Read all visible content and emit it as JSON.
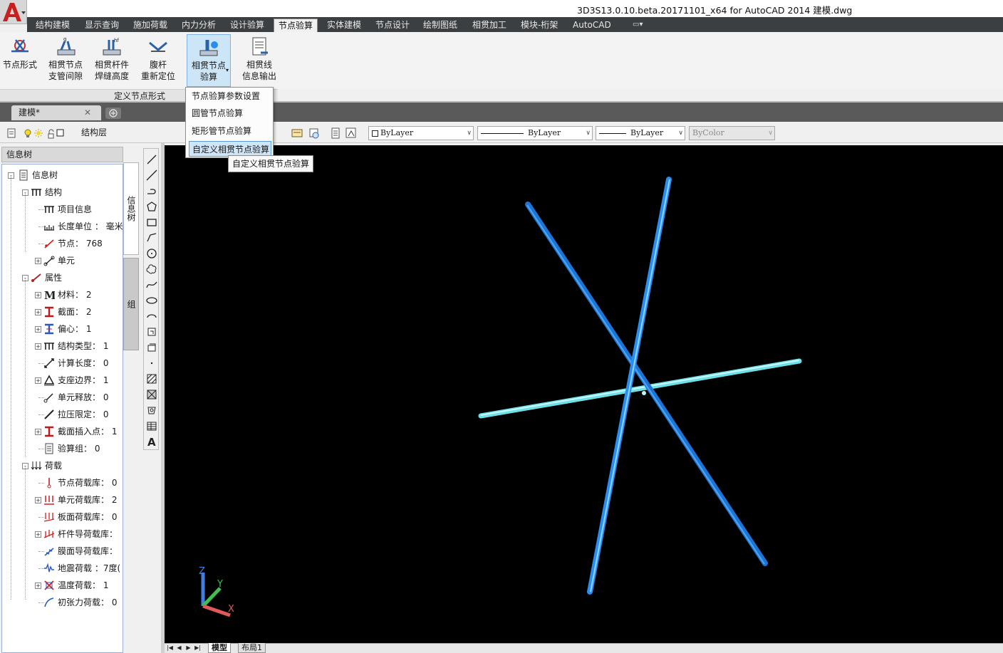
{
  "window": {
    "title": "3D3S13.0.10.beta.20171101_x64 for AutoCAD 2014     建模.dwg"
  },
  "ribbon": {
    "tabs": [
      {
        "label": "结构建模"
      },
      {
        "label": "显示查询"
      },
      {
        "label": "施加荷载"
      },
      {
        "label": "内力分析"
      },
      {
        "label": "设计验算"
      },
      {
        "label": "节点验算"
      },
      {
        "label": "实体建模"
      },
      {
        "label": "节点设计"
      },
      {
        "label": "绘制图纸"
      },
      {
        "label": "相贯加工"
      },
      {
        "label": "模块-桁架"
      },
      {
        "label": "AutoCAD"
      }
    ],
    "active_tab": "节点验算",
    "buttons": [
      {
        "line1": "节点形式",
        "line2": "",
        "icon": "node-form-icon"
      },
      {
        "line1": "相贯节点",
        "line2": "支管间隙",
        "icon": "branch-gap-icon"
      },
      {
        "line1": "相贯杆件",
        "line2": "焊缝高度",
        "icon": "weld-height-icon"
      },
      {
        "line1": "腹杆",
        "line2": "重新定位",
        "icon": "web-reposition-icon"
      },
      {
        "line1": "相贯节点",
        "line2": "验算",
        "icon": "joint-check-icon"
      },
      {
        "line1": "相贯线",
        "line2": "信息输出",
        "icon": "info-output-icon"
      }
    ],
    "group_title": "定义节点形式"
  },
  "dropdown_menu": {
    "items": [
      {
        "label": "节点验算参数设置"
      },
      {
        "label": "圆管节点验算"
      },
      {
        "label": "矩形管节点验算"
      },
      {
        "label": "自定义相贯节点验算"
      }
    ],
    "selected": "自定义相贯节点验算",
    "tooltip": "自定义相贯节点验算"
  },
  "document": {
    "tab": "建模*",
    "close_glyph": "✕"
  },
  "properties": {
    "layer": "结构层",
    "color": "ByLayer",
    "linetype": "ByLayer",
    "lineweight": "ByLayer",
    "plotstyle": "ByColor"
  },
  "left_panel": {
    "header": "信息树",
    "side_tabs": [
      "信息树",
      "组"
    ],
    "tree": [
      {
        "label": "信息树",
        "level": 0,
        "exp": "-",
        "icon": "document-icon"
      },
      {
        "label": "结构",
        "level": 1,
        "exp": "-",
        "icon": "frame-icon"
      },
      {
        "label": "项目信息",
        "level": 2,
        "exp": "",
        "icon": "frame-icon"
      },
      {
        "label": "长度单位 ： 毫米",
        "level": 2,
        "exp": "",
        "icon": "ruler-icon"
      },
      {
        "label": "节点： 768",
        "level": 2,
        "exp": "",
        "icon": "node-icon"
      },
      {
        "label": "单元",
        "level": 2,
        "exp": "+",
        "icon": "element-icon"
      },
      {
        "label": "属性",
        "level": 1,
        "exp": "-",
        "icon": "property-icon"
      },
      {
        "label": "材料： 2",
        "level": 2,
        "exp": "+",
        "icon": "material-icon"
      },
      {
        "label": "截面： 2",
        "level": 2,
        "exp": "+",
        "icon": "section-icon"
      },
      {
        "label": "偏心： 1",
        "level": 2,
        "exp": "+",
        "icon": "eccentric-icon"
      },
      {
        "label": "结构类型： 1",
        "level": 2,
        "exp": "+",
        "icon": "frame-icon"
      },
      {
        "label": "计算长度： 0",
        "level": 2,
        "exp": "",
        "icon": "length-icon"
      },
      {
        "label": "支座边界： 1",
        "level": 2,
        "exp": "+",
        "icon": "support-icon"
      },
      {
        "label": "单元释放： 0",
        "level": 2,
        "exp": "",
        "icon": "release-icon"
      },
      {
        "label": "拉压限定： 0",
        "level": 2,
        "exp": "",
        "icon": "tension-icon"
      },
      {
        "label": "截面插入点： 1",
        "level": 2,
        "exp": "+",
        "icon": "section-icon"
      },
      {
        "label": "验算组： 0",
        "level": 2,
        "exp": "",
        "icon": "document-icon"
      },
      {
        "label": "荷载",
        "level": 1,
        "exp": "-",
        "icon": "load-icon"
      },
      {
        "label": "节点荷载库： 0",
        "level": 2,
        "exp": "",
        "icon": "node-load-icon"
      },
      {
        "label": "单元荷载库： 2",
        "level": 2,
        "exp": "+",
        "icon": "element-load-icon"
      },
      {
        "label": "板面荷载库： 0",
        "level": 2,
        "exp": "",
        "icon": "plate-load-icon"
      },
      {
        "label": "杆件导荷载库：",
        "level": 2,
        "exp": "+",
        "icon": "member-load-icon"
      },
      {
        "label": "膜面导荷载库：",
        "level": 2,
        "exp": "",
        "icon": "membrane-load-icon"
      },
      {
        "label": "地震荷载 ：7度(",
        "level": 2,
        "exp": "",
        "icon": "seismic-icon"
      },
      {
        "label": "温度荷载： 1",
        "level": 2,
        "exp": "+",
        "icon": "temperature-icon"
      },
      {
        "label": "初张力荷载： 0",
        "level": 2,
        "exp": "",
        "icon": "pretension-icon"
      }
    ]
  },
  "draw_tools": [
    "line-icon",
    "xline-icon",
    "pline-icon",
    "polygon-icon",
    "rectangle-icon",
    "arc-icon",
    "circle-icon",
    "revcloud-icon",
    "spline-icon",
    "ellipse-icon",
    "ellipse-arc-icon",
    "insert-block-icon",
    "make-block-icon",
    "point-icon",
    "hatch-icon",
    "gradient-icon",
    "region-icon",
    "table-icon",
    "mtext-icon"
  ],
  "layout_tabs": [
    "模型",
    "布局1"
  ],
  "ucs": {
    "z": "Z",
    "y": "Y",
    "x": "X"
  },
  "colors": {
    "accent": "#1e78d8",
    "member_dark": "#1c74d6",
    "member_light": "#6fe0e8",
    "viewport_bg": "#000000",
    "autocad_red": "#c8201e"
  }
}
